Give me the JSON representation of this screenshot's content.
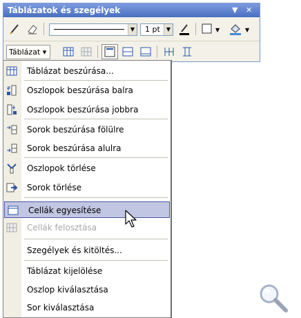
{
  "toolbar": {
    "title": "Táblázatok és szegélyek",
    "title_menu_glyph": "▼",
    "title_close_glyph": "✕",
    "line_weight": "1 pt",
    "table_button_label": "Táblázat ▾"
  },
  "menu": {
    "items": [
      {
        "label": "Táblázat beszúrása...",
        "icon": "insert-table-icon",
        "disabled": false
      },
      {
        "label": "Oszlopok beszúrása balra",
        "icon": "insert-columns-left-icon",
        "disabled": false
      },
      {
        "label": "Oszlopok beszúrása jobbra",
        "icon": "insert-columns-right-icon",
        "disabled": false
      },
      {
        "label": "Sorok beszúrása fölülre",
        "icon": "insert-rows-above-icon",
        "disabled": false
      },
      {
        "label": "Sorok beszúrása alulra",
        "icon": "insert-rows-below-icon",
        "disabled": false
      },
      {
        "label": "Oszlopok törlése",
        "icon": "delete-columns-icon",
        "disabled": false
      },
      {
        "label": "Sorok törlése",
        "icon": "delete-rows-icon",
        "disabled": false
      },
      {
        "label": "Cellák egyesítése",
        "icon": "merge-cells-icon",
        "disabled": false,
        "highlighted": true
      },
      {
        "label": "Cellák felosztása",
        "icon": "split-cells-icon",
        "disabled": true
      },
      {
        "label": "Szegélyek és kitöltés...",
        "icon": "",
        "disabled": false
      },
      {
        "label": "Táblázat kijelölése",
        "icon": "",
        "disabled": false
      },
      {
        "label": "Oszlop kiválasztása",
        "icon": "",
        "disabled": false
      },
      {
        "label": "Sor kiválasztása",
        "icon": "",
        "disabled": false
      }
    ]
  },
  "colors": {
    "title_bar": "#4a6fc0",
    "highlight": "#c1c6e2",
    "highlight_border": "#4a55a5",
    "gutter": "#f1eee3",
    "disabled_text": "#a7a7a7"
  }
}
